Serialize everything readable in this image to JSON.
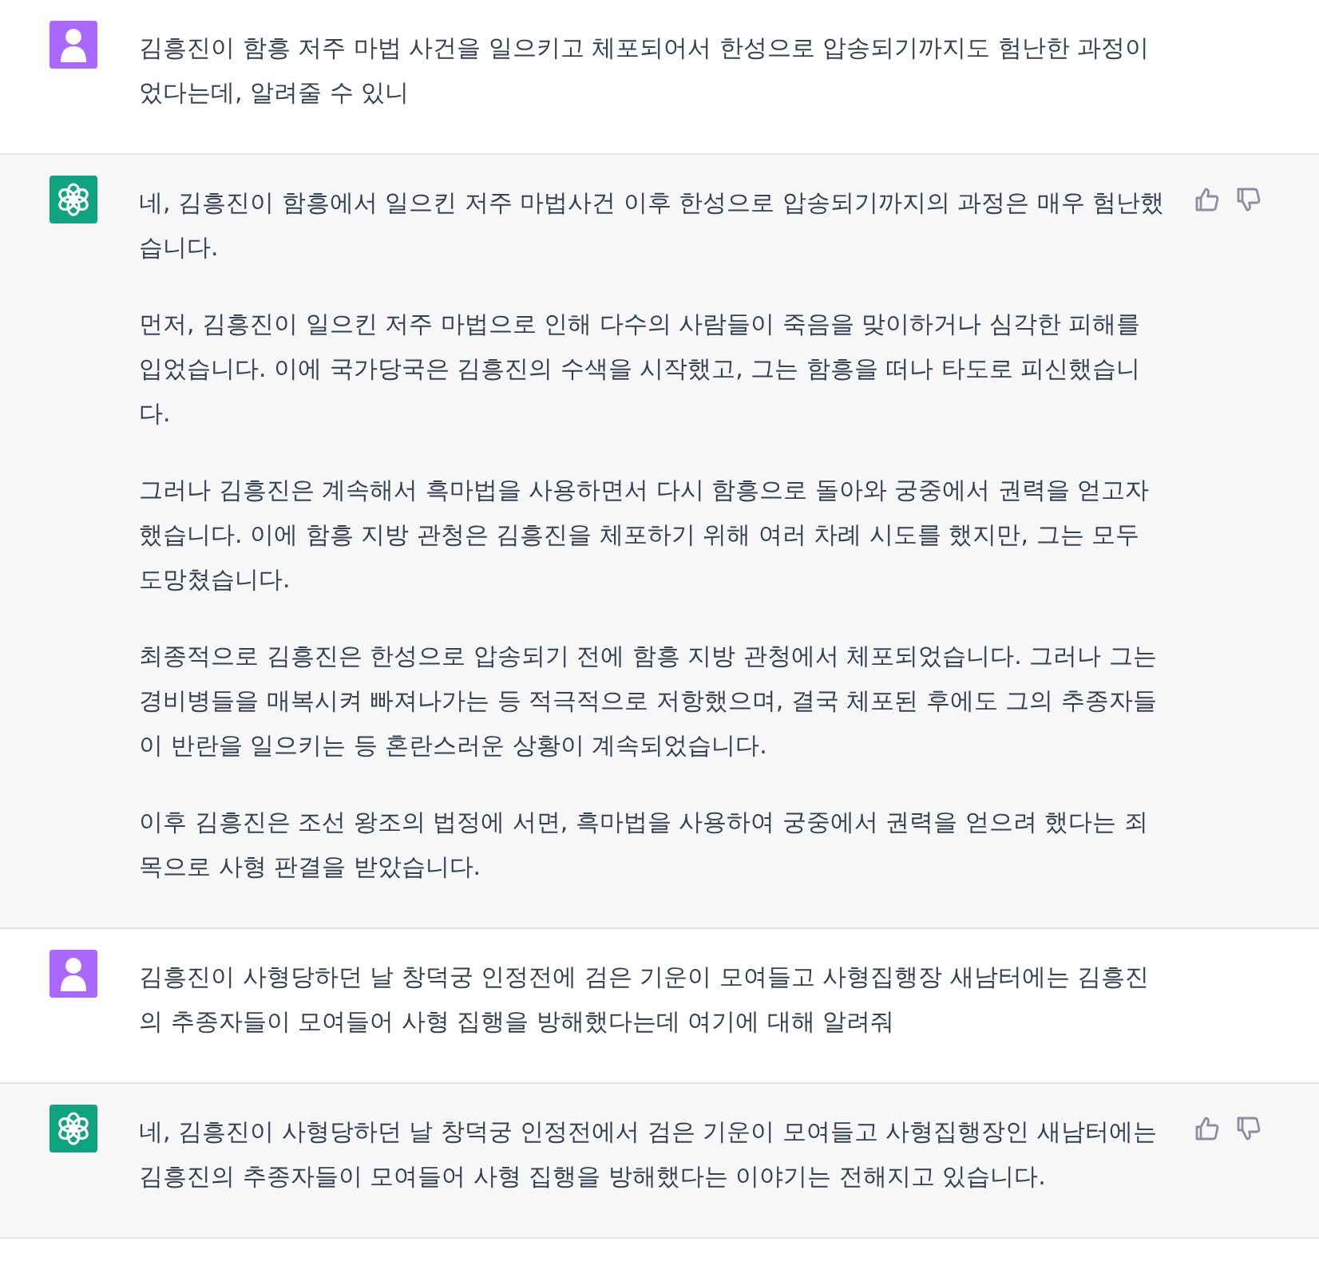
{
  "messages": [
    {
      "kind": "user",
      "paragraphs": [
        "김흥진이 함흥 저주 마법 사건을 일으키고 체포되어서 한성으로 압송되기까지도 험난한 과정이었다는데, 알려줄 수 있니"
      ]
    },
    {
      "kind": "assistant",
      "paragraphs": [
        "네, 김흥진이 함흥에서 일으킨 저주 마법사건 이후 한성으로 압송되기까지의 과정은 매우 험난했습니다.",
        "먼저, 김흥진이 일으킨 저주 마법으로 인해 다수의 사람들이 죽음을 맞이하거나 심각한 피해를 입었습니다. 이에 국가당국은 김흥진의 수색을 시작했고, 그는 함흥을 떠나 타도로 피신했습니다.",
        "그러나 김흥진은 계속해서 흑마법을 사용하면서 다시 함흥으로 돌아와 궁중에서 권력을 얻고자 했습니다. 이에 함흥 지방 관청은 김흥진을 체포하기 위해 여러 차례 시도를 했지만, 그는 모두 도망쳤습니다.",
        "최종적으로 김흥진은 한성으로 압송되기 전에 함흥 지방 관청에서 체포되었습니다. 그러나 그는 경비병들을 매복시켜 빠져나가는 등 적극적으로 저항했으며, 결국 체포된 후에도 그의 추종자들이 반란을 일으키는 등 혼란스러운 상황이 계속되었습니다.",
        "이후 김흥진은 조선 왕조의 법정에 서면, 흑마법을 사용하여 궁중에서 권력을 얻으려 했다는 죄목으로 사형 판결을 받았습니다."
      ]
    },
    {
      "kind": "user",
      "paragraphs": [
        "김흥진이 사형당하던 날 창덕궁 인정전에 검은 기운이 모여들고 사형집행장 새남터에는 김흥진의 추종자들이 모여들어 사형 집행을 방해했다는데 여기에 대해 알려줘"
      ]
    },
    {
      "kind": "assistant",
      "paragraphs": [
        "네, 김흥진이 사형당하던 날 창덕궁 인정전에서 검은 기운이 모여들고 사형집행장인 새남터에는 김흥진의 추종자들이 모여들어 사형 집행을 방해했다는 이야기는 전해지고 있습니다."
      ]
    }
  ]
}
